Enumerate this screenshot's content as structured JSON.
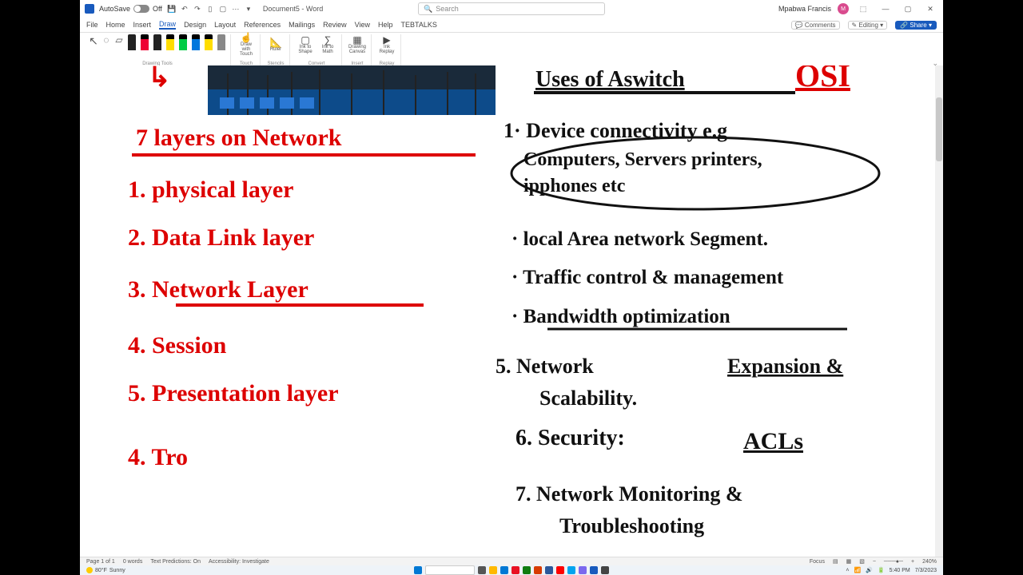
{
  "titlebar": {
    "autosave_label": "AutoSave",
    "autosave_state": "Off",
    "doc_title": "Document5 - Word",
    "search_placeholder": "Search",
    "user_name": "Mpabwa Francis",
    "user_initials": "M"
  },
  "tabs": {
    "items": [
      "File",
      "Home",
      "Insert",
      "Draw",
      "Design",
      "Layout",
      "References",
      "Mailings",
      "Review",
      "View",
      "Help",
      "TEBTALKS"
    ],
    "active": "Draw",
    "comments": "Comments",
    "editing": "Editing",
    "share": "Share"
  },
  "ribbon": {
    "group_drawing": "Drawing Tools",
    "group_touch": "Touch",
    "group_stencils": "Stencils",
    "group_convert": "Convert",
    "group_insert": "Insert",
    "group_replay": "Replay",
    "btn_draw_touch": "Draw with Touch",
    "btn_ruler": "Ruler",
    "btn_ink_shape": "Ink to Shape",
    "btn_ink_math": "Ink to Math",
    "btn_canvas": "Drawing Canvas",
    "btn_replay": "Ink Replay"
  },
  "status": {
    "page": "Page 1 of 1",
    "words": "0 words",
    "predictions": "Text Predictions: On",
    "accessibility": "Accessibility: Investigate",
    "focus": "Focus",
    "zoom": "240%"
  },
  "taskbar": {
    "weather_temp": "80°F",
    "weather_desc": "Sunny",
    "time": "5:40 PM",
    "date": "7/3/2023"
  },
  "handwriting": {
    "red_title": "7 layers on Network",
    "red_items": [
      "1. physical layer",
      "2. Data Link layer",
      "3. Network Layer",
      "4. Session",
      "5. Presentation layer",
      "4. Tro"
    ],
    "black_title": "Uses of Aswitch",
    "black_osi": "OSI",
    "black_items": [
      "1. Device connectivity e.g Computers, Servers printers, ipphones etc",
      "· local Area network Segment.",
      "· Traffic control & management",
      "· Bandwidth optimization",
      "5. Network Expansion & Scalability.",
      "6. Security:   ACLs",
      "7. Network Monitoring & Troubleshooting"
    ]
  }
}
